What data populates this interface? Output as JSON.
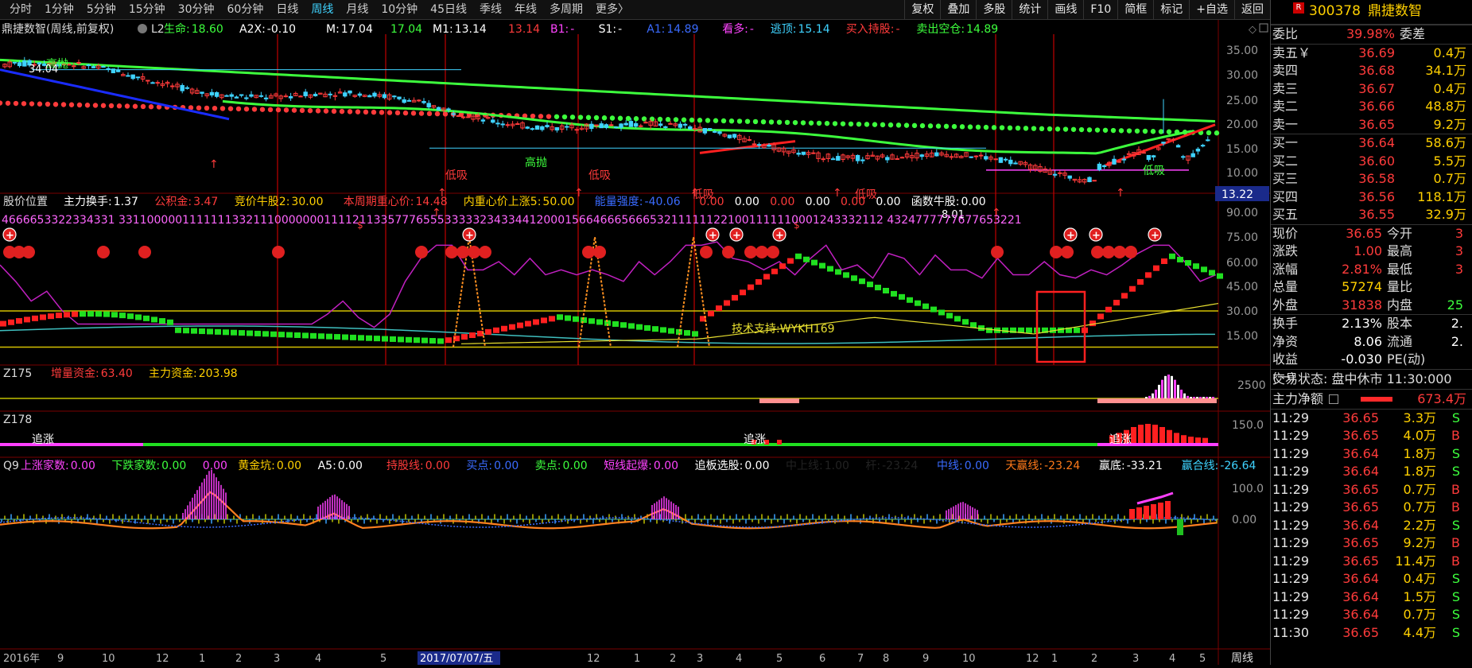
{
  "toolbar": {
    "periods": [
      "分时",
      "1分钟",
      "5分钟",
      "15分钟",
      "30分钟",
      "60分钟",
      "日线",
      "周线",
      "月线",
      "10分钟",
      "45日线",
      "季线",
      "年线",
      "多周期",
      "更多〉"
    ],
    "active_period_index": 7,
    "tools": [
      "复权",
      "叠加",
      "多股",
      "统计",
      "画线",
      "F10",
      "简框",
      "标记",
      "+自选",
      "返回"
    ]
  },
  "main_chart": {
    "title": "鼎捷数智(周线,前复权)",
    "indicator_name": "L2",
    "items": [
      {
        "label": "生命:",
        "value": "18.60",
        "color": "#3dff3d"
      },
      {
        "label": "A2X:",
        "value": "-0.10",
        "color": "#ffffff"
      },
      {
        "label": "M:",
        "value": "17.04",
        "color": "#ffffff"
      },
      {
        "label": "",
        "value": "17.04",
        "color": "#3dff3d"
      },
      {
        "label": "M1:",
        "value": "13.14",
        "color": "#ffffff"
      },
      {
        "label": "",
        "value": "13.14",
        "color": "#ff3b3b"
      },
      {
        "label": "B1:",
        "value": "-",
        "color": "#ff44ff"
      },
      {
        "label": "S1:",
        "value": "-",
        "color": "#ffffff"
      },
      {
        "label": "A1:",
        "value": "14.89",
        "color": "#3a6bff"
      },
      {
        "label": "看多:",
        "value": "-",
        "color": "#ff44ff"
      },
      {
        "label": "逃顶:",
        "value": "15.14",
        "color": "#3fd3ff"
      },
      {
        "label": "买入持股:",
        "value": "-",
        "color": "#ff3b3b"
      },
      {
        "label": "卖出空仓:",
        "value": "14.89",
        "color": "#3dff3d"
      }
    ],
    "y_labels": [
      "35.00",
      "30.00",
      "25.00",
      "20.00",
      "15.00",
      "10.00"
    ],
    "current_price_tag": "13.22",
    "high_label": "34.04",
    "low_label": "8.01",
    "annotations": [
      "高抛",
      "低吸",
      "低吸",
      "高抛",
      "低吸",
      "低吸",
      "低吸",
      "高抛"
    ]
  },
  "position_panel": {
    "title": "股价位置",
    "items": [
      {
        "label": "主力换手:",
        "value": "1.37",
        "color": "#ffffff"
      },
      {
        "label": "公积金:",
        "value": "3.47",
        "color": "#ff3b3b"
      },
      {
        "label": "竞价牛股2:",
        "value": "30.00",
        "color": "#ffd000"
      },
      {
        "label": "本周期重心价:",
        "value": "14.48",
        "color": "#ff3b3b"
      },
      {
        "label": "内重心价上涨5:",
        "value": "50.00",
        "color": "#ffd000"
      },
      {
        "label": "能量强度:",
        "value": "-40.06",
        "color": "#3a6bff"
      },
      {
        "label": "",
        "value": "0.00",
        "color": "#ff3b3b"
      },
      {
        "label": "",
        "value": "0.00",
        "color": "#ffffff"
      },
      {
        "label": "",
        "value": "0.00",
        "color": "#ff3b3b"
      },
      {
        "label": "",
        "value": "0.00",
        "color": "#ffffff"
      },
      {
        "label": "",
        "value": "0.00",
        "color": "#ff3b3b"
      },
      {
        "label": "",
        "value": "0.00",
        "color": "#ffffff"
      },
      {
        "label": "函数牛股:",
        "value": "0.00",
        "color": "#ffffff"
      }
    ],
    "digit_row": "4666653322334331 331100000111111133211100000001111211335777655533333234334412000156646665666532111111221001111110001243332112 4324777777677653221",
    "y_labels": [
      "90.00",
      "75.00",
      "60.00",
      "45.00",
      "30.00",
      "15.00"
    ],
    "annotation": "技术支持:WYKH169"
  },
  "z175": {
    "title": "Z175",
    "items": [
      {
        "label": "增量资金:",
        "value": "63.40",
        "color": "#ff3b3b"
      },
      {
        "label": "主力资金:",
        "value": "203.98",
        "color": "#ffd000"
      }
    ],
    "y_labels": [
      "2500"
    ]
  },
  "z178": {
    "title": "Z178",
    "y_labels": [
      "150.0"
    ],
    "labels": [
      "追涨",
      "追涨",
      "追涨"
    ]
  },
  "q9": {
    "title": "Q9",
    "items": [
      {
        "label": "上涨家数:",
        "value": "0.00",
        "color": "#ff44ff"
      },
      {
        "label": "下跌家数:",
        "value": "0.00",
        "color": "#3dff3d"
      },
      {
        "label": "",
        "value": "0.00",
        "color": "#ff44ff"
      },
      {
        "label": "黄金坑:",
        "value": "0.00",
        "color": "#ffd000"
      },
      {
        "label": "A5:",
        "value": "0.00",
        "color": "#ffffff"
      },
      {
        "label": "持股线:",
        "value": "0.00",
        "color": "#ff3b3b"
      },
      {
        "label": "买点:",
        "value": "0.00",
        "color": "#3a6bff"
      },
      {
        "label": "卖点:",
        "value": "0.00",
        "color": "#3dff3d"
      },
      {
        "label": "短线起爆:",
        "value": "0.00",
        "color": "#ff44ff"
      },
      {
        "label": "追板选股:",
        "value": "0.00",
        "color": "#ffffff"
      },
      {
        "label": "中上线:",
        "value": "1.00",
        "color": "#222222"
      },
      {
        "label": "杆:",
        "value": "-23.24",
        "color": "#222222"
      },
      {
        "label": "中线:",
        "value": "0.00",
        "color": "#3a6bff"
      },
      {
        "label": "天赢线:",
        "value": "-23.24",
        "color": "#ff7a1a"
      },
      {
        "label": "赢底:",
        "value": "-33.21",
        "color": "#ffffff"
      },
      {
        "label": "赢合线:",
        "value": "-26.64",
        "color": "#3fd3ff"
      }
    ],
    "y_labels": [
      "100.0",
      "0.00"
    ]
  },
  "x_axis": {
    "labels": [
      "2016年",
      "9",
      "10",
      "12",
      "1",
      "2",
      "3",
      "4",
      "5",
      "6",
      "",
      "",
      "",
      "12",
      "1",
      "2",
      "3",
      "4",
      "5",
      "6",
      "7",
      "8",
      "9",
      "10",
      "12",
      "1",
      "2",
      "3",
      "4",
      "5"
    ],
    "cursor_date": "2017/07/07/五",
    "corner": "周线"
  },
  "quote": {
    "code": "300378",
    "name": "鼎捷数智",
    "badge": "R",
    "weibi_label": "委比",
    "weibi_value": "39.98%",
    "weicha_label": "委差",
    "asks": [
      {
        "label": "卖五￥",
        "price": "36.69",
        "vol": "0.4万"
      },
      {
        "label": "卖四",
        "price": "36.68",
        "vol": "34.1万"
      },
      {
        "label": "卖三",
        "price": "36.67",
        "vol": "0.4万"
      },
      {
        "label": "卖二",
        "price": "36.66",
        "vol": "48.8万"
      },
      {
        "label": "卖一",
        "price": "36.65",
        "vol": "9.2万"
      }
    ],
    "bids": [
      {
        "label": "买一",
        "price": "36.64",
        "vol": "58.6万"
      },
      {
        "label": "买二",
        "price": "36.60",
        "vol": "5.5万"
      },
      {
        "label": "买三",
        "price": "36.58",
        "vol": "0.7万"
      },
      {
        "label": "买四",
        "price": "36.56",
        "vol": "118.1万"
      },
      {
        "label": "买五",
        "price": "36.55",
        "vol": "32.9万"
      }
    ],
    "info": [
      {
        "l1": "现价",
        "v1": "36.65",
        "c1": "red",
        "l2": "今开",
        "v2": "3",
        "c2": "red"
      },
      {
        "l1": "涨跌",
        "v1": "1.00",
        "c1": "red",
        "l2": "最高",
        "v2": "3",
        "c2": "red"
      },
      {
        "l1": "涨幅",
        "v1": "2.81%",
        "c1": "red",
        "l2": "最低",
        "v2": "3",
        "c2": "red"
      },
      {
        "l1": "总量",
        "v1": "57274",
        "c1": "yellow",
        "l2": "量比",
        "v2": "",
        "c2": "yellow"
      },
      {
        "l1": "外盘",
        "v1": "31838",
        "c1": "red",
        "l2": "内盘",
        "v2": "25",
        "c2": "green"
      },
      {
        "l1": "换手",
        "v1": "2.13%",
        "c1": "white",
        "l2": "股本",
        "v2": "2.",
        "c2": "white"
      },
      {
        "l1": "净资",
        "v1": "8.06",
        "c1": "white",
        "l2": "流通",
        "v2": "2.",
        "c2": "white"
      },
      {
        "l1": "收益(一)",
        "v1": "-0.030",
        "c1": "white",
        "l2": "PE(动)",
        "v2": "",
        "c2": "white"
      }
    ],
    "status": "交易状态: 盘中休市 11:30:000",
    "netflow_label": "主力净额",
    "netflow_value": "673.4万",
    "ticks": [
      {
        "t": "11:29",
        "p": "36.65",
        "v": "3.3万",
        "f": "S"
      },
      {
        "t": "11:29",
        "p": "36.65",
        "v": "4.0万",
        "f": "B"
      },
      {
        "t": "11:29",
        "p": "36.64",
        "v": "1.8万",
        "f": "S"
      },
      {
        "t": "11:29",
        "p": "36.64",
        "v": "1.8万",
        "f": "S"
      },
      {
        "t": "11:29",
        "p": "36.65",
        "v": "0.7万",
        "f": "B"
      },
      {
        "t": "11:29",
        "p": "36.65",
        "v": "0.7万",
        "f": "B"
      },
      {
        "t": "11:29",
        "p": "36.64",
        "v": "2.2万",
        "f": "S"
      },
      {
        "t": "11:29",
        "p": "36.65",
        "v": "9.2万",
        "f": "B"
      },
      {
        "t": "11:29",
        "p": "36.65",
        "v": "11.4万",
        "f": "B"
      },
      {
        "t": "11:29",
        "p": "36.64",
        "v": "0.4万",
        "f": "S"
      },
      {
        "t": "11:29",
        "p": "36.64",
        "v": "1.5万",
        "f": "S"
      },
      {
        "t": "11:29",
        "p": "36.64",
        "v": "0.7万",
        "f": "S"
      },
      {
        "t": "11:30",
        "p": "36.65",
        "v": "4.4万",
        "f": "S"
      }
    ]
  }
}
